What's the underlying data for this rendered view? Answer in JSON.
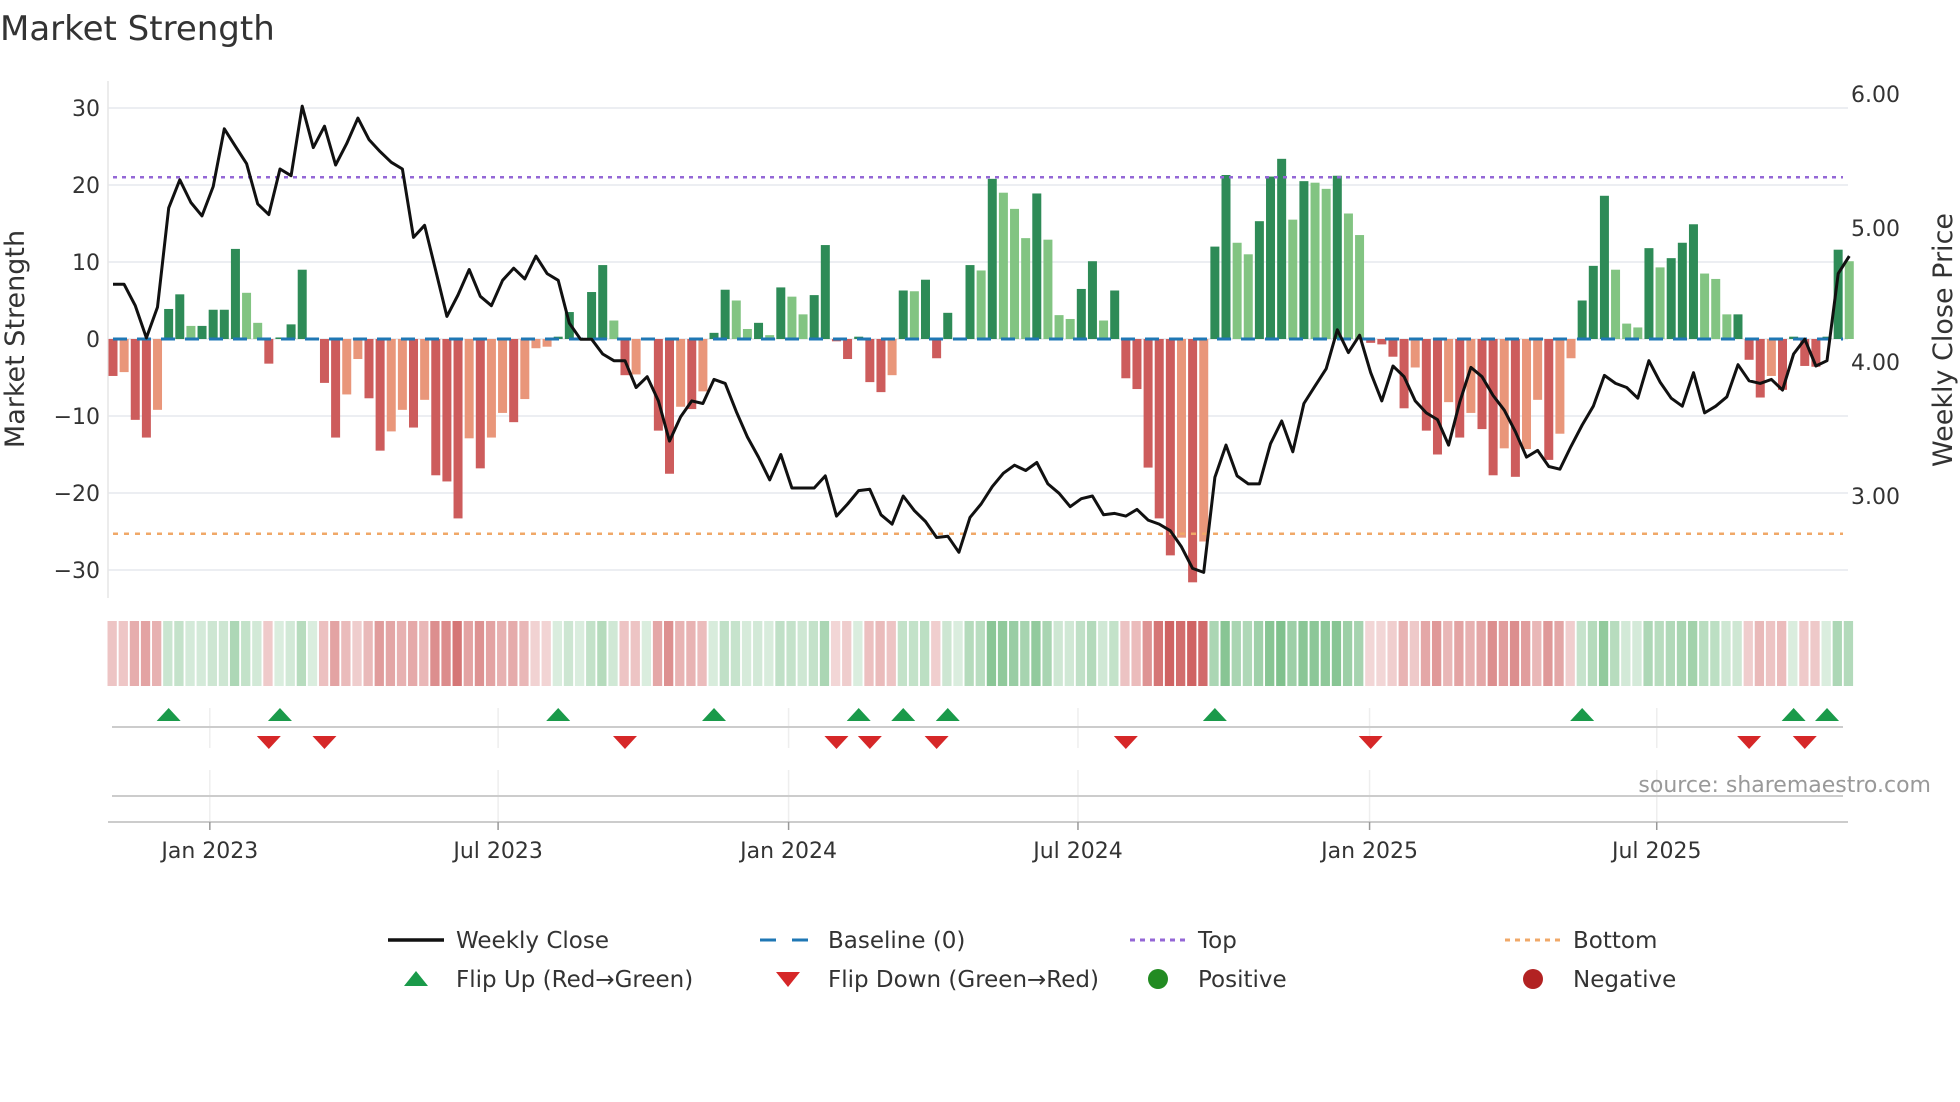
{
  "chart_data": {
    "type": "bar",
    "title": "Market Strength",
    "ylabel": "Market Strength",
    "y2label": "Weekly Close Price",
    "ylim": [
      -33,
      33
    ],
    "y2lim": [
      2.35,
      6.1
    ],
    "yticks": [
      30,
      20,
      10,
      0,
      -10,
      -20,
      -30
    ],
    "yticklabels": [
      "30",
      "20",
      "10",
      "0",
      "−10",
      "−20",
      "−30"
    ],
    "y2ticks": [
      6,
      5,
      4,
      3
    ],
    "y2ticklabels": [
      "6.00",
      "5.00",
      "4.00",
      "3.00"
    ],
    "xticks": [
      {
        "week_index": 8.7,
        "label": "Jan 2023"
      },
      {
        "week_index": 34.6,
        "label": "Jul 2023"
      },
      {
        "week_index": 60.7,
        "label": "Jan 2024"
      },
      {
        "week_index": 86.7,
        "label": "Jul 2024"
      },
      {
        "week_index": 112.9,
        "label": "Jan 2025"
      },
      {
        "week_index": 138.7,
        "label": "Jul 2025"
      }
    ],
    "top_level": 21,
    "bottom_level": -25.3,
    "baseline": 0,
    "strength": [
      -4.8,
      -4.3,
      -10.5,
      -12.8,
      -9.2,
      3.9,
      5.8,
      1.7,
      1.7,
      3.8,
      3.8,
      11.7,
      6.0,
      2.1,
      -3.2,
      0.2,
      1.9,
      9.0,
      0,
      -5.7,
      -12.8,
      -7.2,
      -2.6,
      -7.7,
      -14.5,
      -12.0,
      -9.2,
      -11.5,
      -7.9,
      -17.7,
      -18.5,
      -23.3,
      -12.9,
      -16.8,
      -12.8,
      -9.6,
      -10.8,
      -7.8,
      -1.2,
      -1.0,
      0.3,
      3.5,
      0,
      6.1,
      9.6,
      2.4,
      -4.7,
      -4.6,
      0,
      -11.9,
      -17.5,
      -8.8,
      -9.1,
      -6.8,
      0.8,
      6.4,
      5.0,
      1.3,
      2.1,
      0.5,
      6.7,
      5.5,
      3.2,
      5.7,
      12.2,
      -0.3,
      -2.6,
      0.3,
      -5.6,
      -6.9,
      -4.7,
      6.3,
      6.2,
      7.7,
      -2.5,
      3.4,
      0,
      9.6,
      8.9,
      20.8,
      19.0,
      16.9,
      13.1,
      18.9,
      12.9,
      3.1,
      2.6,
      6.5,
      10.1,
      2.4,
      6.3,
      -5.1,
      -6.5,
      -16.7,
      -23.3,
      -28.1,
      -25.8,
      -31.6,
      -26.3,
      12.0,
      21.3,
      12.5,
      11.0,
      15.3,
      21.1,
      23.4,
      15.5,
      20.5,
      20.3,
      19.5,
      21.2,
      16.3,
      13.5,
      -0.5,
      -0.7,
      -2.3,
      -9.0,
      -3.7,
      -11.9,
      -15.0,
      -8.2,
      -12.8,
      -9.6,
      -11.7,
      -17.7,
      -14.2,
      -17.9,
      -14.3,
      -7.9,
      -15.7,
      -12.3,
      -2.5,
      5.0,
      9.5,
      18.6,
      9.0,
      2.0,
      1.5,
      11.8,
      9.3,
      10.5,
      12.5,
      14.9,
      8.5,
      7.8,
      3.2,
      3.2,
      -2.7,
      -7.6,
      -4.8,
      -6.6,
      0.3,
      -3.5,
      -3.6,
      0.3,
      11.6,
      10.1
    ],
    "weekly_close": [
      4.58,
      4.58,
      4.42,
      4.18,
      4.41,
      5.15,
      5.36,
      5.19,
      5.09,
      5.31,
      5.74,
      5.61,
      5.48,
      5.18,
      5.1,
      5.44,
      5.39,
      5.91,
      5.6,
      5.76,
      5.47,
      5.63,
      5.82,
      5.66,
      5.57,
      5.49,
      5.44,
      4.93,
      5.02,
      4.68,
      4.34,
      4.5,
      4.69,
      4.49,
      4.42,
      4.61,
      4.7,
      4.62,
      4.79,
      4.66,
      4.61,
      4.29,
      4.17,
      4.17,
      4.06,
      4.01,
      4.01,
      3.81,
      3.89,
      3.71,
      3.41,
      3.59,
      3.71,
      3.69,
      3.87,
      3.84,
      3.63,
      3.44,
      3.29,
      3.12,
      3.31,
      3.06,
      3.06,
      3.06,
      3.15,
      2.85,
      2.94,
      3.04,
      3.05,
      2.86,
      2.79,
      3.0,
      2.89,
      2.81,
      2.69,
      2.7,
      2.58,
      2.84,
      2.94,
      3.07,
      3.17,
      3.23,
      3.19,
      3.25,
      3.09,
      3.02,
      2.92,
      2.98,
      3.0,
      2.86,
      2.87,
      2.85,
      2.9,
      2.82,
      2.79,
      2.74,
      2.62,
      2.46,
      2.43,
      3.14,
      3.38,
      3.15,
      3.09,
      3.09,
      3.39,
      3.56,
      3.33,
      3.69,
      3.82,
      3.95,
      4.24,
      4.07,
      4.2,
      3.92,
      3.71,
      3.97,
      3.89,
      3.71,
      3.62,
      3.57,
      3.38,
      3.7,
      3.96,
      3.89,
      3.75,
      3.64,
      3.48,
      3.29,
      3.34,
      3.22,
      3.2,
      3.37,
      3.53,
      3.67,
      3.9,
      3.84,
      3.81,
      3.73,
      4.01,
      3.85,
      3.73,
      3.67,
      3.92,
      3.62,
      3.67,
      3.74,
      3.98,
      3.86,
      3.84,
      3.87,
      3.79,
      4.06,
      4.17,
      3.97,
      4.01,
      4.66,
      4.79
    ],
    "flip_up_indices": [
      5,
      15,
      40,
      54,
      67,
      71,
      75,
      99,
      132,
      151,
      154
    ],
    "flip_down_indices": [
      14,
      19,
      46,
      65,
      68,
      74,
      91,
      113,
      147,
      152
    ],
    "source": "source: sharemaestro.com",
    "legend": [
      {
        "label": "Weekly Close",
        "kind": "line",
        "color": "#111111"
      },
      {
        "label": "Baseline (0)",
        "kind": "dash",
        "color": "#1f77b4"
      },
      {
        "label": "Top",
        "kind": "dot",
        "color": "#9467d6"
      },
      {
        "label": "Bottom",
        "kind": "dot",
        "color": "#f0a868"
      },
      {
        "label": "Flip Up (Red→Green)",
        "kind": "tri-up",
        "color": "#1a9a4a"
      },
      {
        "label": "Flip Down (Green→Red)",
        "kind": "tri-down",
        "color": "#d62728"
      },
      {
        "label": "Positive",
        "kind": "circle",
        "color": "#228b22"
      },
      {
        "label": "Negative",
        "kind": "circle",
        "color": "#b22222"
      }
    ],
    "colors": {
      "pos_strong": "#2e8b57",
      "pos_weak": "#82c482",
      "neg_strong": "#cd5c5c",
      "neg_weak": "#e9967a",
      "grid": "#eceef2",
      "axis": "#cccccc"
    }
  }
}
